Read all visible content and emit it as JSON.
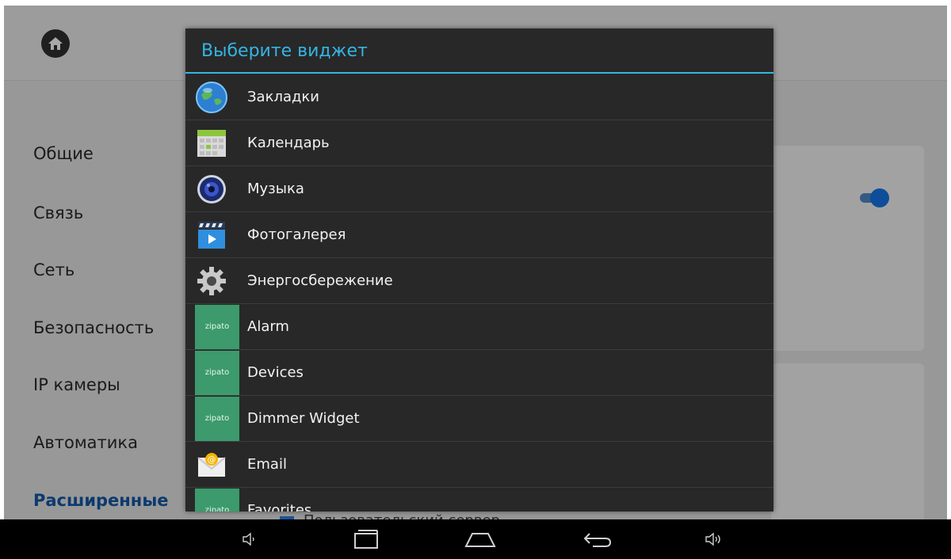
{
  "sidebar": {
    "items": [
      {
        "label": "Общие"
      },
      {
        "label": "Связь"
      },
      {
        "label": "Сеть"
      },
      {
        "label": "Безопасность"
      },
      {
        "label": "IP камеры"
      },
      {
        "label": "Автоматика"
      },
      {
        "label": "Расширенные"
      }
    ],
    "active_index": 6
  },
  "background": {
    "checkbox_label": "Пользовательский сервер",
    "toggle_state": "on"
  },
  "dialog": {
    "title": "Выберите виджет",
    "items": [
      {
        "label": "Закладки",
        "icon": "globe-icon"
      },
      {
        "label": "Календарь",
        "icon": "calendar-icon"
      },
      {
        "label": "Музыка",
        "icon": "music-icon"
      },
      {
        "label": "Фотогалерея",
        "icon": "gallery-icon"
      },
      {
        "label": "Энергосбережение",
        "icon": "gear-icon"
      },
      {
        "label": "Alarm",
        "icon": "zipato-icon",
        "badge": "zipato"
      },
      {
        "label": "Devices",
        "icon": "zipato-icon",
        "badge": "zipato"
      },
      {
        "label": "Dimmer Widget",
        "icon": "zipato-icon",
        "badge": "zipato"
      },
      {
        "label": "Email",
        "icon": "email-icon"
      },
      {
        "label": "Favorites",
        "icon": "zipato-icon",
        "badge": "zipato"
      }
    ]
  },
  "colors": {
    "accent": "#33b5e5",
    "dialog_bg": "#282828",
    "active_nav": "#0d3a6e",
    "zipato_green": "#3c9a6c"
  },
  "navbar": {
    "buttons": [
      "volume-down-icon",
      "recent-apps-icon",
      "home-nav-icon",
      "back-icon",
      "volume-up-icon"
    ]
  }
}
